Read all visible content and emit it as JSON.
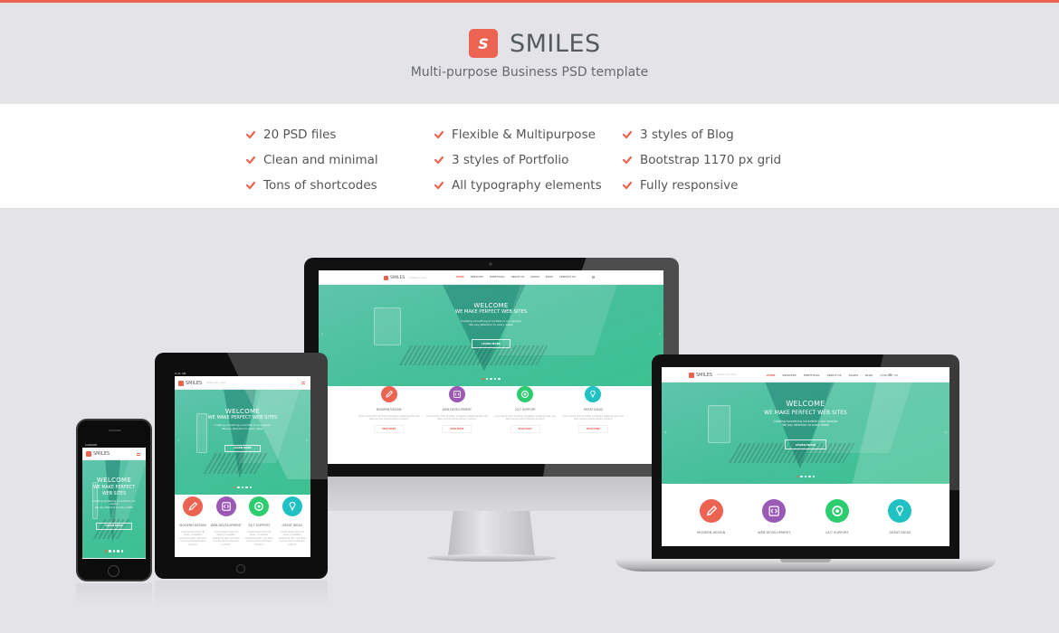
{
  "colors": {
    "accent": "#ec6451",
    "teal": "#45bf9a",
    "purple": "#9b59b6",
    "green": "#2ecc71",
    "cyan": "#1fc1c3",
    "background": "#e3e3e8"
  },
  "header": {
    "logo_letter": "S",
    "brand": "SMILES",
    "tagline": "Multi-purpose Business PSD template"
  },
  "features": {
    "columns": [
      [
        "20 PSD files",
        "Clean and minimal",
        "Tons of shortcodes"
      ],
      [
        "Flexible & Multipurpose",
        "3 styles of Portfolio",
        "All typography elements"
      ],
      [
        "3 styles of Blog",
        "Bootstrap 1170 px grid",
        "Fully responsive"
      ]
    ],
    "icon": "check-icon"
  },
  "mockup": {
    "logo_letter": "S",
    "brand": "SMILES",
    "brand_tagline": "simple and clean",
    "nav": [
      "HOME",
      "SERVICES",
      "PORTFOLIO",
      "ABOUT US",
      "PAGES",
      "BLOG",
      "CONTACT US"
    ],
    "nav_active": "HOME",
    "search_icon": "search-icon",
    "menu_icon": "hamburger-icon",
    "hero": {
      "title": "WELCOME",
      "subtitle": "WE MAKE PERFECT WEB SITES",
      "text_line1": "Creating something incredible is our passion",
      "text_line2": "We pay attention to every detail",
      "button": "LEARN MORE",
      "slides": 5,
      "active_slide": 1
    },
    "services": [
      {
        "title": "MODERN DESIGN",
        "icon": "pencil-icon",
        "color": "#ec6451"
      },
      {
        "title": "WEB DEVELOPMENT",
        "icon": "code-icon",
        "color": "#9b59b6"
      },
      {
        "title": "24/7 SUPPORT",
        "icon": "lifebuoy-icon",
        "color": "#2ecc71"
      },
      {
        "title": "GREAT IDEAS",
        "icon": "lightbulb-icon",
        "color": "#1fc1c3"
      }
    ],
    "service_text": "Lorem ipsum dolor sit amet, consetetur sadipscing elitr, sed diam nonumy eirmod tempor invidunt.",
    "read_more": "READ MORE",
    "status_carrier": "CARRIER",
    "status_time": "9:41 AM"
  }
}
